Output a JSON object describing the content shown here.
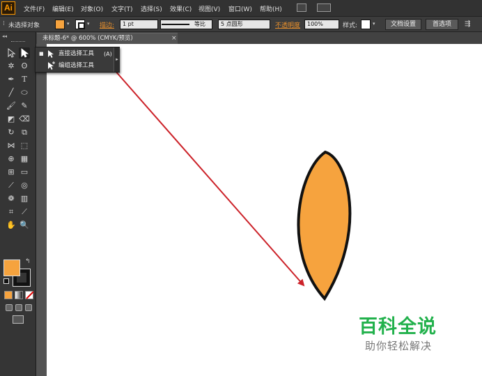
{
  "app": {
    "logo": "Ai"
  },
  "menu": {
    "items": [
      "文件(F)",
      "编辑(E)",
      "对象(O)",
      "文字(T)",
      "选择(S)",
      "效果(C)",
      "视图(V)",
      "窗口(W)",
      "帮助(H)"
    ]
  },
  "control_bar": {
    "selection_label": "未选择对象",
    "stroke_label": "描边:",
    "stroke_weight": "1 pt",
    "stroke_profile": "等比",
    "brush": "5 点圆形",
    "opacity_label": "不透明度",
    "opacity_value": "100%",
    "style_label": "样式:",
    "doc_setup_button": "文档设置",
    "preferences_button": "首选项",
    "fill_color": "#f6a33e"
  },
  "document": {
    "tab_title": "未标题-6* @ 600% (CMYK/预览)",
    "close_glyph": "×"
  },
  "flyout": {
    "items": [
      {
        "label": "直接选择工具",
        "shortcut": "(A)",
        "bullet": "■"
      },
      {
        "label": "编组选择工具",
        "shortcut": "",
        "bullet": ""
      }
    ],
    "tearoff": "▸"
  },
  "artwork": {
    "shape_fill": "#f6a33e",
    "shape_stroke": "#111111",
    "arrow_color": "#cc2229"
  },
  "watermark": {
    "title": "百科全说",
    "subtitle": "助你轻松解决",
    "title_color": "#22b14c"
  }
}
